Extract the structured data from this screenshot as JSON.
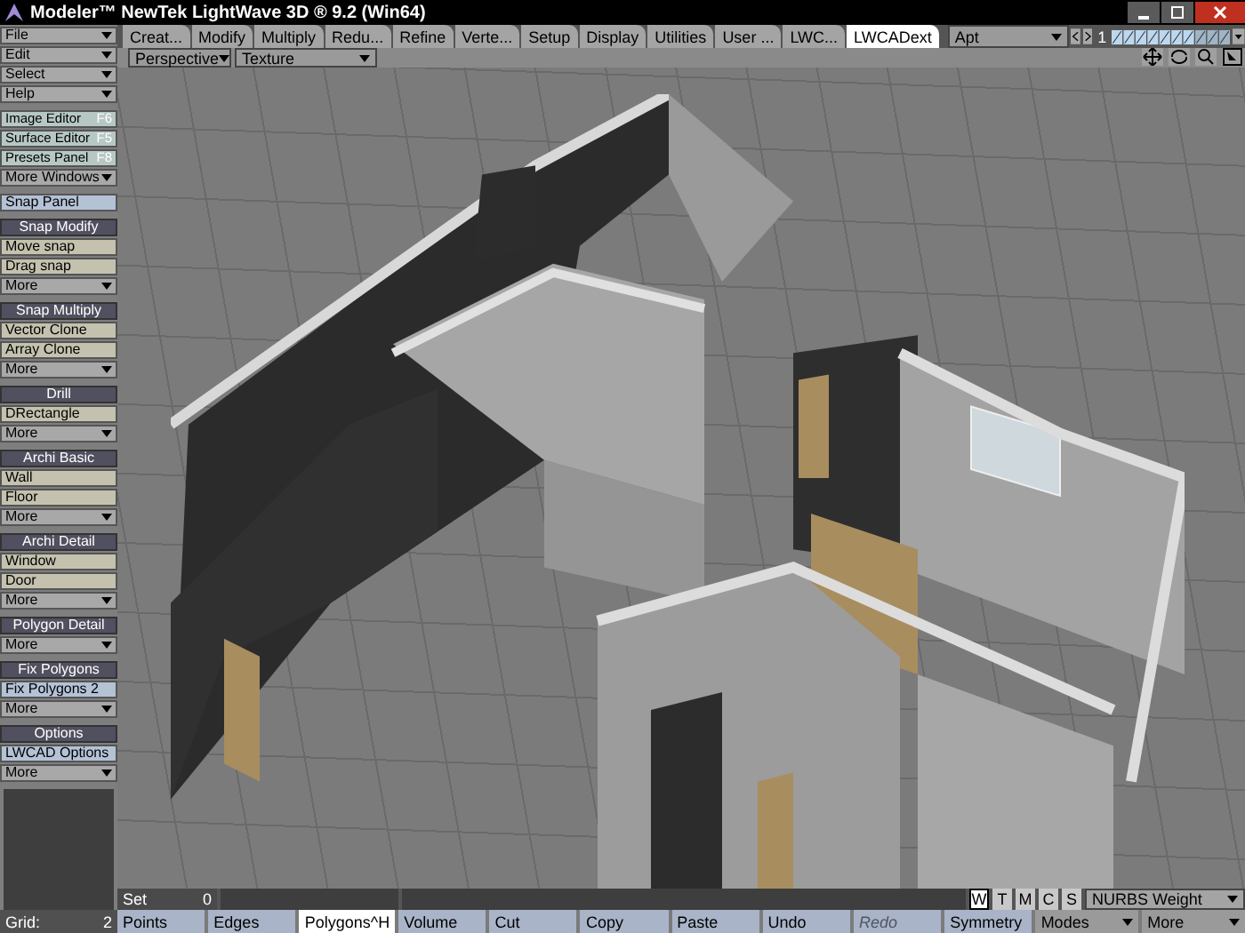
{
  "window": {
    "title": "Modeler™ NewTek LightWave 3D ® 9.2 (Win64)"
  },
  "tabs": [
    {
      "label": "Creat...",
      "selected": false
    },
    {
      "label": "Modify",
      "selected": false
    },
    {
      "label": "Multiply",
      "selected": false
    },
    {
      "label": "Redu...",
      "selected": false
    },
    {
      "label": "Refine",
      "selected": false
    },
    {
      "label": "Verte...",
      "selected": false
    },
    {
      "label": "Setup",
      "selected": false
    },
    {
      "label": "Display",
      "selected": false
    },
    {
      "label": "Utilities",
      "selected": false
    },
    {
      "label": "User ...",
      "selected": false
    },
    {
      "label": "LWC...",
      "selected": false
    },
    {
      "label": "LWCADext",
      "selected": true
    }
  ],
  "layer_set": {
    "value": "Apt",
    "page": "1"
  },
  "viewport": {
    "view": "Perspective",
    "shading": "Texture"
  },
  "sidebar": [
    {
      "items": [
        {
          "kind": "menu",
          "label": "File"
        },
        {
          "kind": "menu",
          "label": "Edit"
        },
        {
          "kind": "menu",
          "label": "Select"
        },
        {
          "kind": "menu",
          "label": "Help"
        }
      ]
    },
    {
      "items": [
        {
          "kind": "window",
          "label": "Image Editor",
          "key": "F6"
        },
        {
          "kind": "window",
          "label": "Surface Editor",
          "key": "F5"
        },
        {
          "kind": "window",
          "label": "Presets Panel",
          "key": "F8"
        },
        {
          "kind": "menu",
          "label": "More Windows"
        }
      ]
    },
    {
      "items": [
        {
          "kind": "panel",
          "label": "Snap Panel"
        }
      ]
    },
    {
      "items": [
        {
          "kind": "header",
          "label": "Snap Modify"
        },
        {
          "kind": "tool",
          "label": "Move snap"
        },
        {
          "kind": "tool",
          "label": "Drag snap"
        },
        {
          "kind": "menu",
          "label": "More"
        }
      ]
    },
    {
      "items": [
        {
          "kind": "header",
          "label": "Snap Multiply"
        },
        {
          "kind": "tool",
          "label": "Vector Clone"
        },
        {
          "kind": "tool",
          "label": "Array Clone"
        },
        {
          "kind": "menu",
          "label": "More"
        }
      ]
    },
    {
      "items": [
        {
          "kind": "header",
          "label": "Drill"
        },
        {
          "kind": "tool",
          "label": "DRectangle"
        },
        {
          "kind": "menu",
          "label": "More"
        }
      ]
    },
    {
      "items": [
        {
          "kind": "header",
          "label": "Archi Basic"
        },
        {
          "kind": "tool",
          "label": "Wall"
        },
        {
          "kind": "tool",
          "label": "Floor"
        },
        {
          "kind": "menu",
          "label": "More"
        }
      ]
    },
    {
      "items": [
        {
          "kind": "header",
          "label": "Archi Detail"
        },
        {
          "kind": "tool",
          "label": "Window"
        },
        {
          "kind": "tool",
          "label": "Door"
        },
        {
          "kind": "menu",
          "label": "More"
        }
      ]
    },
    {
      "items": [
        {
          "kind": "header",
          "label": "Polygon Detail"
        },
        {
          "kind": "menu",
          "label": "More"
        }
      ]
    },
    {
      "items": [
        {
          "kind": "header",
          "label": "Fix Polygons"
        },
        {
          "kind": "panel",
          "label": "Fix Polygons 2"
        },
        {
          "kind": "menu",
          "label": "More"
        }
      ]
    },
    {
      "items": [
        {
          "kind": "header",
          "label": "Options"
        },
        {
          "kind": "panel",
          "label": "LWCAD Options"
        },
        {
          "kind": "menu",
          "label": "More"
        }
      ]
    }
  ],
  "status": {
    "set_label": "Set",
    "set_value": "0",
    "grid_label": "Grid:",
    "grid_value": "2"
  },
  "component_toggles": [
    {
      "label": "W",
      "selected": true
    },
    {
      "label": "T",
      "selected": false
    },
    {
      "label": "M",
      "selected": false
    },
    {
      "label": "C",
      "selected": false
    },
    {
      "label": "S",
      "selected": false
    }
  ],
  "vertex_map": "NURBS Weight",
  "bottom_buttons": [
    {
      "kind": "button",
      "label": "Points",
      "selected": false,
      "disabled": false
    },
    {
      "kind": "button",
      "label": "Edges",
      "selected": false,
      "disabled": false
    },
    {
      "kind": "button",
      "label": "Polygons",
      "key": "^H",
      "selected": true,
      "disabled": false
    },
    {
      "kind": "button",
      "label": "Volume",
      "selected": false,
      "disabled": false
    },
    {
      "kind": "button",
      "label": "Cut",
      "selected": false,
      "disabled": false
    },
    {
      "kind": "button",
      "label": "Copy",
      "selected": false,
      "disabled": false
    },
    {
      "kind": "button",
      "label": "Paste",
      "selected": false,
      "disabled": false
    },
    {
      "kind": "button",
      "label": "Undo",
      "selected": false,
      "disabled": false
    },
    {
      "kind": "button",
      "label": "Redo",
      "selected": false,
      "disabled": true
    },
    {
      "kind": "button",
      "label": "Symmetry",
      "selected": false,
      "disabled": false
    },
    {
      "kind": "menu",
      "label": "Modes",
      "selected": false,
      "disabled": false
    },
    {
      "kind": "menu",
      "label": "More",
      "selected": false,
      "disabled": false
    }
  ]
}
